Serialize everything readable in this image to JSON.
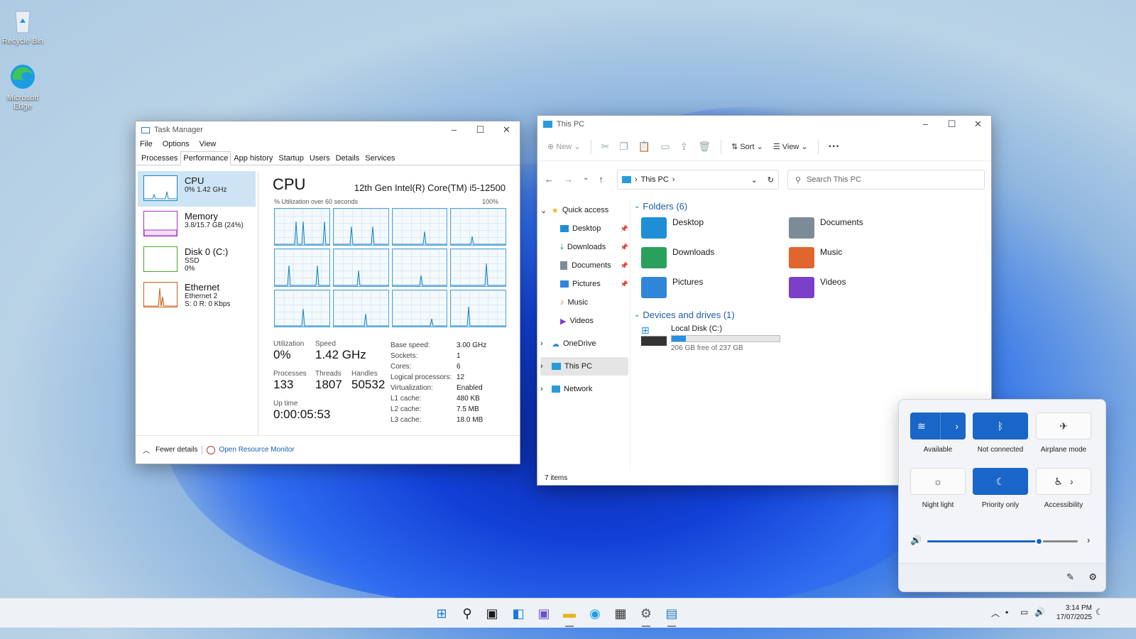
{
  "desktop": {
    "icons": [
      {
        "label": "Recycle Bin"
      },
      {
        "label": "Microsoft Edge"
      }
    ]
  },
  "task_manager": {
    "title": "Task Manager",
    "menu": [
      "File",
      "Options",
      "View"
    ],
    "tabs": [
      "Processes",
      "Performance",
      "App history",
      "Startup",
      "Users",
      "Details",
      "Services"
    ],
    "active_tab": "Performance",
    "resources": [
      {
        "name": "CPU",
        "sub1": "0% 1.42 GHz",
        "sub2": "",
        "sub3": "",
        "color": "#1783c5"
      },
      {
        "name": "Memory",
        "sub1": "3.8/15.7 GB (24%)",
        "sub2": "",
        "sub3": "",
        "color": "#a236b8"
      },
      {
        "name": "Disk 0 (C:)",
        "sub1": "SSD",
        "sub2": "0%",
        "sub3": "",
        "color": "#4ca62b"
      },
      {
        "name": "Ethernet",
        "sub1": "Ethernet 2",
        "sub2": "S: 0 R: 0 Kbps",
        "sub3": "",
        "color": "#c8631c"
      }
    ],
    "cpu_title": "CPU",
    "cpu_model": "12th Gen Intel(R) Core(TM) i5-12500",
    "graph_caption": "% Utilization over 60 seconds",
    "graph_max": "100%",
    "stats": {
      "utilization_label": "Utilization",
      "utilization": "0%",
      "speed_label": "Speed",
      "speed": "1.42 GHz",
      "processes_label": "Processes",
      "processes": "133",
      "threads_label": "Threads",
      "threads": "1807",
      "handles_label": "Handles",
      "handles": "50532",
      "uptime_label": "Up time",
      "uptime": "0:00:05:53"
    },
    "specs": [
      {
        "k": "Base speed:",
        "v": "3.00 GHz"
      },
      {
        "k": "Sockets:",
        "v": "1"
      },
      {
        "k": "Cores:",
        "v": "6"
      },
      {
        "k": "Logical processors:",
        "v": "12"
      },
      {
        "k": "Virtualization:",
        "v": "Enabled"
      },
      {
        "k": "L1 cache:",
        "v": "480 KB"
      },
      {
        "k": "L2 cache:",
        "v": "7.5 MB"
      },
      {
        "k": "L3 cache:",
        "v": "18.0 MB"
      }
    ],
    "fewer_details": "Fewer details",
    "resource_monitor": "Open Resource Monitor"
  },
  "explorer": {
    "title": "This PC",
    "toolbar": {
      "new": "New",
      "sort": "Sort",
      "view": "View",
      "more": "···"
    },
    "address": "This PC",
    "search_placeholder": "Search This PC",
    "nav": {
      "quick_access": "Quick access",
      "items": [
        "Desktop",
        "Downloads",
        "Documents",
        "Pictures",
        "Music",
        "Videos"
      ],
      "onedrive": "OneDrive",
      "this_pc": "This PC",
      "network": "Network"
    },
    "folders_header": "Folders (6)",
    "folders": [
      {
        "name": "Desktop",
        "color": "#1e8fd6"
      },
      {
        "name": "Documents",
        "color": "#7d8b99"
      },
      {
        "name": "Downloads",
        "color": "#2aa05a"
      },
      {
        "name": "Music",
        "color": "#e0652e"
      },
      {
        "name": "Pictures",
        "color": "#2f86d8"
      },
      {
        "name": "Videos",
        "color": "#7c3fc9"
      }
    ],
    "drives_header": "Devices and drives (1)",
    "drive": {
      "name": "Local Disk (C:)",
      "free": "206 GB free of 237 GB",
      "used_fraction": 0.13
    },
    "status": "7 items"
  },
  "quick_settings": {
    "tiles": [
      {
        "label": "Available",
        "icon": "wifi-icon",
        "on": true
      },
      {
        "label": "Not connected",
        "icon": "bluetooth-icon",
        "on": true
      },
      {
        "label": "Airplane mode",
        "icon": "airplane-icon",
        "on": false
      },
      {
        "label": "Night light",
        "icon": "sun-icon",
        "on": false
      },
      {
        "label": "Priority only",
        "icon": "moon-icon",
        "on": true
      },
      {
        "label": "Accessibility",
        "icon": "accessibility-icon",
        "on": false
      }
    ],
    "volume": 0.74
  },
  "taskbar": {
    "time": "3:14 PM",
    "date": "17/07/2025"
  },
  "colors": {
    "accent": "#1a66c8",
    "cpu": "#1783c5"
  }
}
